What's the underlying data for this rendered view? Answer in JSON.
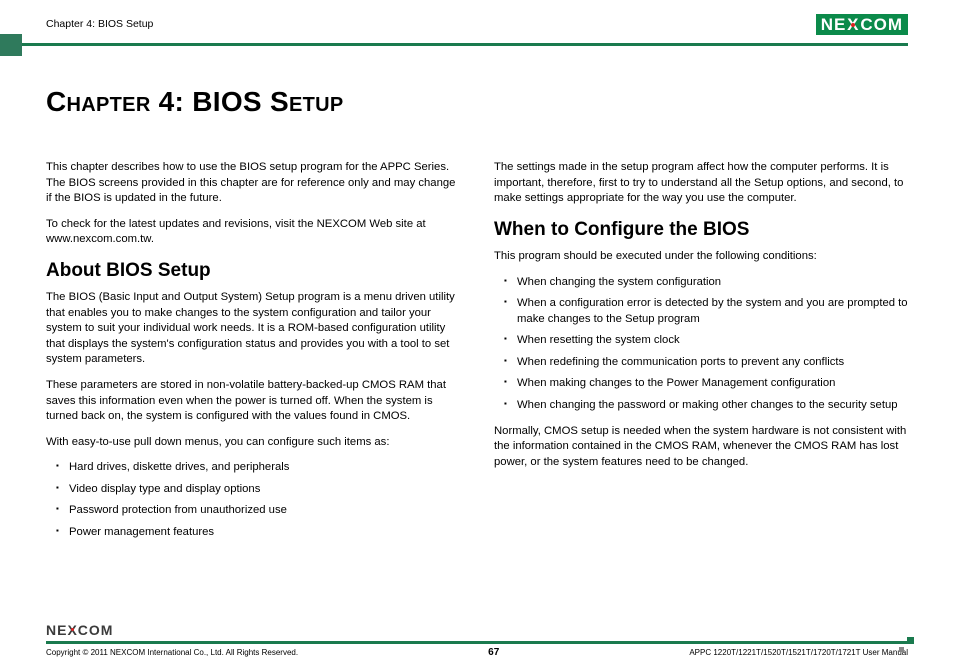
{
  "header": {
    "left": "Chapter 4: BIOS Setup",
    "logo_left": "NE",
    "logo_x": "X",
    "logo_right": "COM"
  },
  "title": "Chapter 4: BIOS Setup",
  "left_col": {
    "intro1": "This chapter describes how to use the BIOS setup program for the APPC Series. The BIOS screens provided in this chapter are for reference only and may change if the BIOS is updated in the future.",
    "intro2": "To check for the latest updates and revisions, visit the NEXCOM Web site at www.nexcom.com.tw.",
    "h_about": "About BIOS Setup",
    "about1": "The BIOS (Basic Input and Output System) Setup program is a menu driven utility that enables you to make changes to the system configuration and tailor your system to suit your individual work needs. It is a ROM-based configuration utility that displays the system's configuration status and provides you with a tool to set system parameters.",
    "about2": "These parameters are stored in non-volatile battery-backed-up CMOS RAM that saves this information even when the power is turned off. When the system is turned back on, the system is configured with the values found in CMOS.",
    "about3": "With easy-to-use pull down menus, you can configure such items as:",
    "about_items": [
      "Hard drives, diskette drives, and peripherals",
      "Video display type and display options",
      "Password protection from unauthorized use",
      "Power management features"
    ]
  },
  "right_col": {
    "intro": "The settings made in the setup program affect how the computer performs. It is important, therefore, first to try to understand all the Setup options, and second, to make settings appropriate for the way you use the computer.",
    "h_when": "When to Configure the BIOS",
    "when_lead": "This program should be executed under the following conditions:",
    "when_items": [
      "When changing the system configuration",
      "When a configuration error is detected by the system and you are prompted to make changes to the Setup program",
      "When resetting the system clock",
      "When redefining the communication ports to prevent any conflicts",
      "When making changes to the Power Management configuration",
      "When changing the password or making other changes to the security setup"
    ],
    "when_end": "Normally, CMOS setup is needed when the system hardware is not consistent with the information contained in the CMOS RAM, whenever the CMOS RAM has lost power, or the system features need to be changed."
  },
  "footer": {
    "copyright": "Copyright © 2011 NEXCOM International Co., Ltd. All Rights Reserved.",
    "page": "67",
    "manual": "APPC 1220T/1221T/1520T/1521T/1720T/1721T User Manual"
  }
}
